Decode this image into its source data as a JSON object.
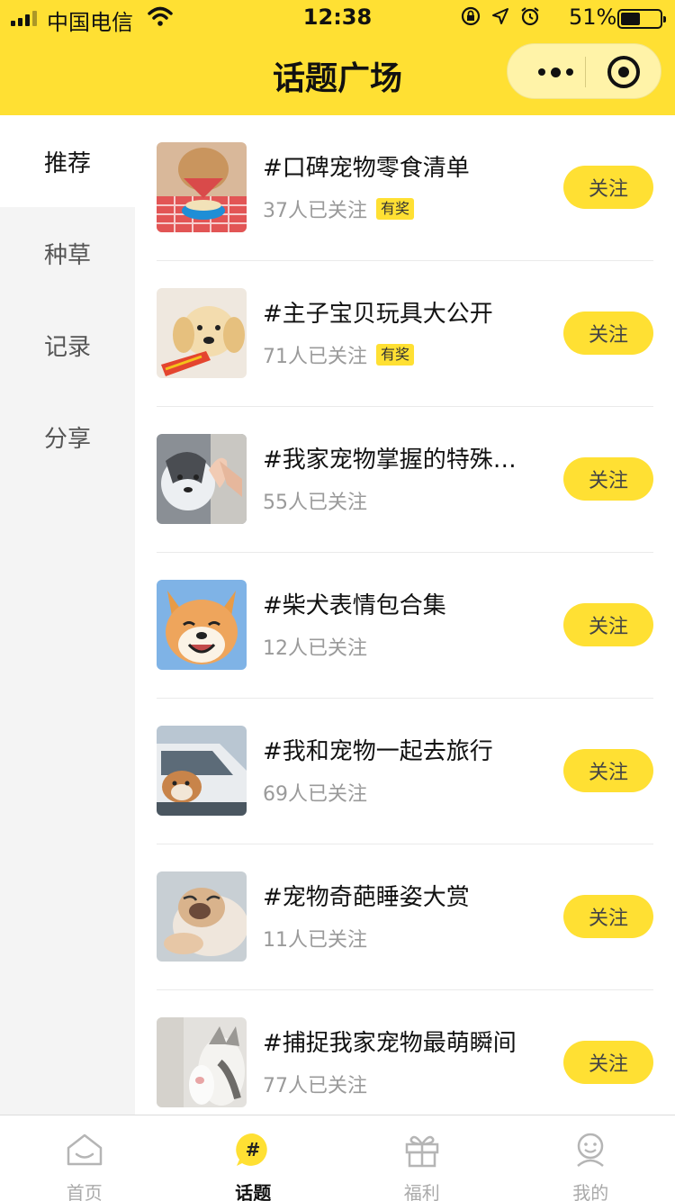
{
  "status_bar": {
    "carrier": "中国电信",
    "time": "12:38",
    "battery": "51%",
    "battery_level": 0.51
  },
  "header": {
    "title": "话题广场"
  },
  "sidebar": {
    "items": [
      {
        "label": "推荐",
        "active": true
      },
      {
        "label": "种草",
        "active": false
      },
      {
        "label": "记录",
        "active": false
      },
      {
        "label": "分享",
        "active": false
      }
    ]
  },
  "topics": [
    {
      "title": "#口碑宠物零食清单",
      "count": "37人已关注",
      "badge": "有奖",
      "follow": "关注",
      "thumb": "dog-food-bowl"
    },
    {
      "title": "#主子宝贝玩具大公开",
      "count": "71人已关注",
      "badge": "有奖",
      "follow": "关注",
      "thumb": "golden-puppy-toy"
    },
    {
      "title": "#我家宠物掌握的特殊…",
      "count": "55人已关注",
      "badge": "",
      "follow": "关注",
      "thumb": "husky-high-five"
    },
    {
      "title": "#柴犬表情包合集",
      "count": "12人已关注",
      "badge": "",
      "follow": "关注",
      "thumb": "shiba-smile"
    },
    {
      "title": "#我和宠物一起去旅行",
      "count": "69人已关注",
      "badge": "",
      "follow": "关注",
      "thumb": "bulldog-car"
    },
    {
      "title": "#宠物奇葩睡姿大赏",
      "count": "11人已关注",
      "badge": "",
      "follow": "关注",
      "thumb": "pug-sleeping"
    },
    {
      "title": "#捕捉我家宠物最萌瞬间",
      "count": "77人已关注",
      "badge": "",
      "follow": "关注",
      "thumb": "cat-paw"
    }
  ],
  "tabbar": {
    "tabs": [
      {
        "label": "首页",
        "icon": "home-icon",
        "active": false
      },
      {
        "label": "话题",
        "icon": "hashtag-icon",
        "active": true
      },
      {
        "label": "福利",
        "icon": "gift-icon",
        "active": false
      },
      {
        "label": "我的",
        "icon": "profile-icon",
        "active": false
      }
    ]
  },
  "colors": {
    "accent": "#FFE033",
    "sidebar_bg": "#F4F4F4",
    "muted_text": "#9A9A9A"
  }
}
